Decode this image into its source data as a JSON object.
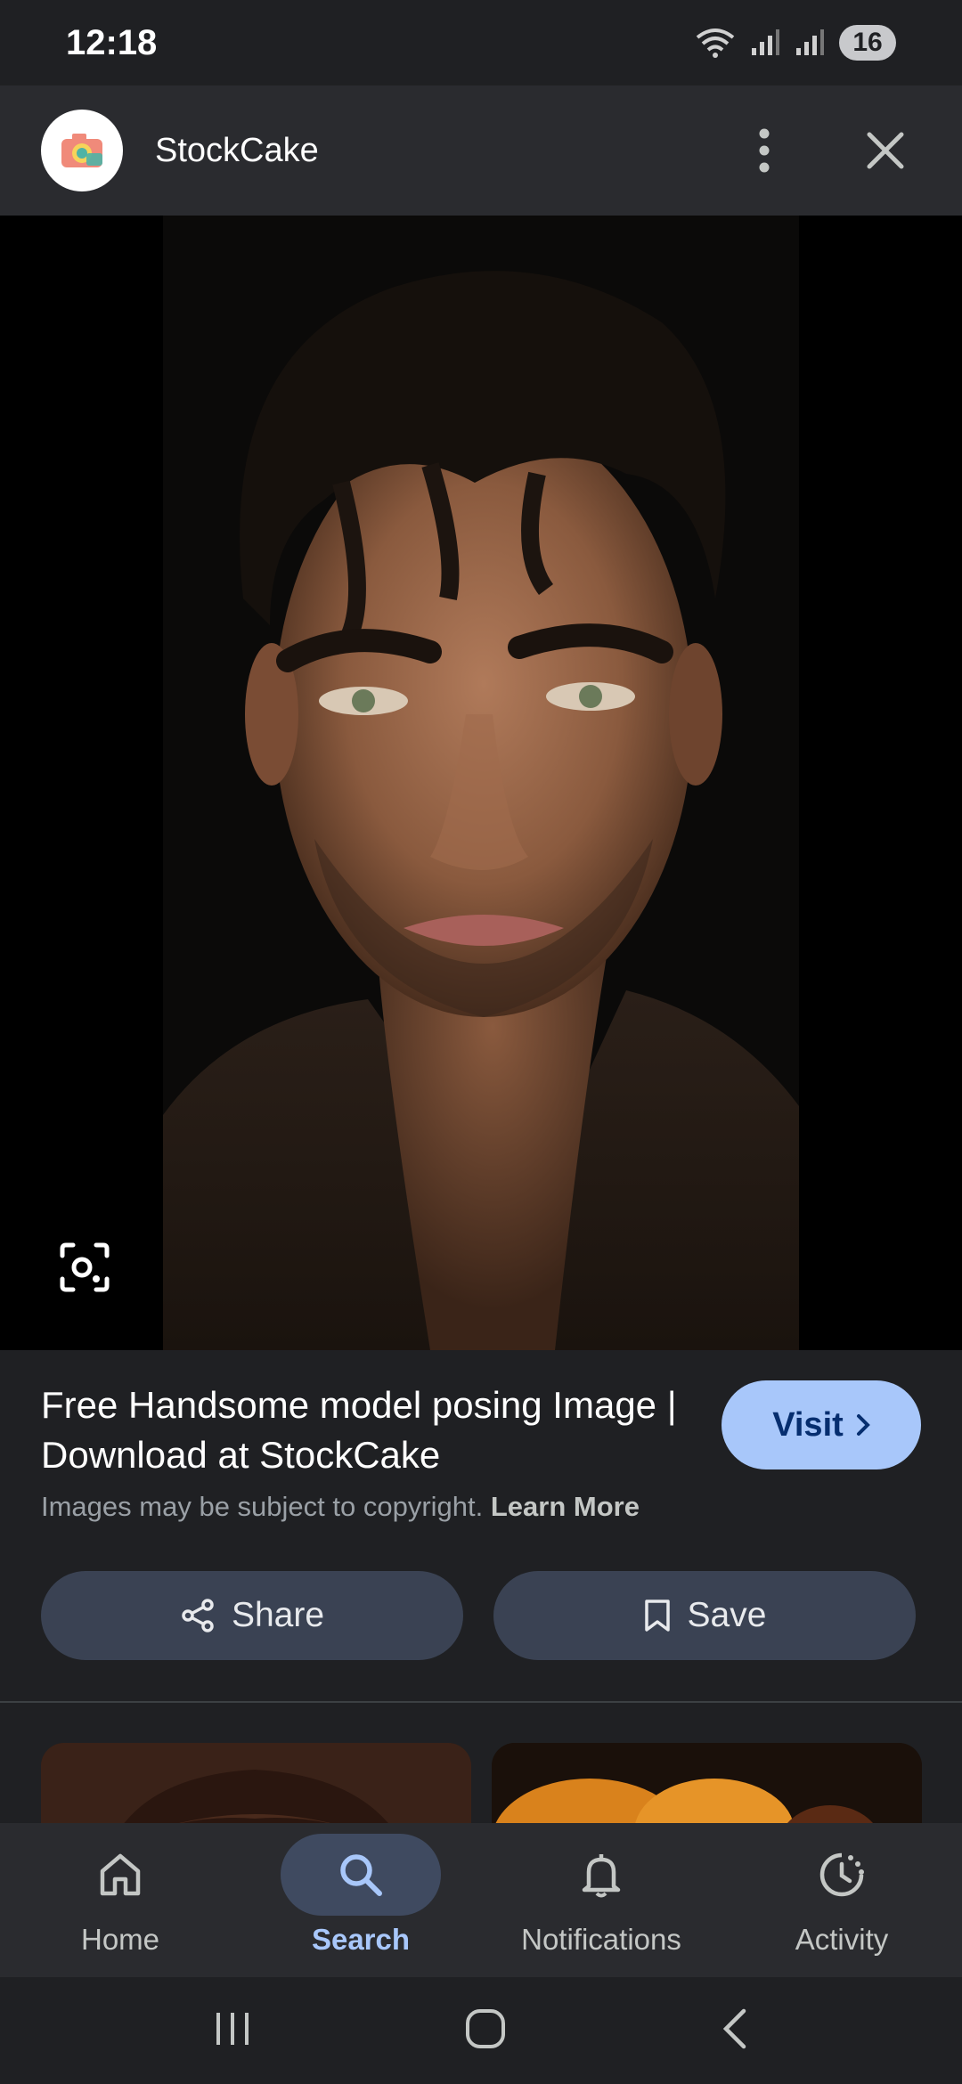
{
  "status_bar": {
    "time": "12:18",
    "battery": "16"
  },
  "header": {
    "site_name": "StockCake"
  },
  "result": {
    "title": "Free Handsome model posing Image | Download at StockCake",
    "visit_label": "Visit",
    "copyright_text": "Images may be subject to copyright.",
    "learn_more": "Learn More"
  },
  "actions": {
    "share_label": "Share",
    "save_label": "Save"
  },
  "bottom_nav": {
    "items": [
      {
        "label": "Home",
        "icon": "home-icon"
      },
      {
        "label": "Search",
        "icon": "search-icon",
        "active": true
      },
      {
        "label": "Notifications",
        "icon": "bell-icon"
      },
      {
        "label": "Activity",
        "icon": "activity-icon"
      }
    ]
  },
  "colors": {
    "accent": "#a8c7fa",
    "background": "#1f2023",
    "button": "#3a4253"
  }
}
